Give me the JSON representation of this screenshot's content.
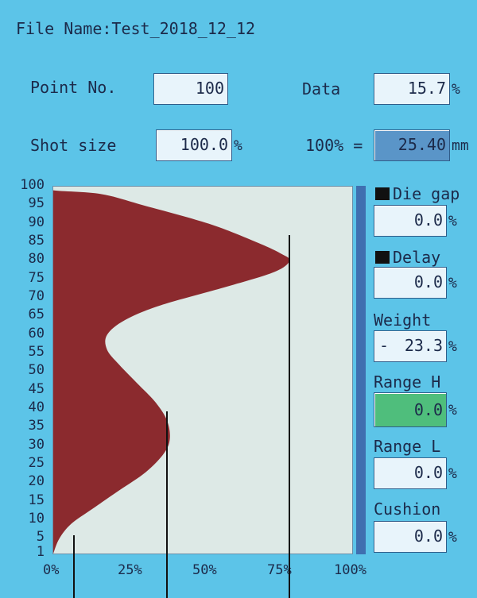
{
  "file_name": "File Name:Test_2018_12_12",
  "point_no": {
    "label": "Point No.",
    "value": "100"
  },
  "data": {
    "label": "Data",
    "value": "15.7",
    "unit": "%"
  },
  "shot_size": {
    "label": "Shot size",
    "value": "100.0",
    "unit": "%"
  },
  "hundred_pct": {
    "label": "100% =",
    "value": "25.40",
    "unit": "mm"
  },
  "chart": {
    "y_ticks": [
      "100",
      "95",
      "90",
      "85",
      "80",
      "75",
      "70",
      "65",
      "60",
      "55",
      "50",
      "45",
      "40",
      "35",
      "30",
      "25",
      "20",
      "15",
      "10",
      "5",
      "1"
    ],
    "x_ticks": [
      "0%",
      "25%",
      "50%",
      "75%",
      "100%"
    ]
  },
  "side": {
    "die_gap": {
      "label": "Die gap",
      "value": "0.0",
      "unit": "%"
    },
    "delay": {
      "label": "Delay",
      "value": "0.0",
      "unit": "%"
    },
    "weight": {
      "label": "Weight",
      "prefix": "-",
      "value": "23.3",
      "unit": "%"
    },
    "range_h": {
      "label": "Range H",
      "value": "0.0",
      "unit": "%"
    },
    "range_l": {
      "label": "Range L",
      "value": "0.0",
      "unit": "%"
    },
    "cushion": {
      "label": "Cushion",
      "value": "0.0",
      "unit": "%"
    }
  },
  "colors": {
    "background": "#5cc4e8",
    "profile_fill": "#8b2a2e",
    "plot_bg": "#dde9e6",
    "highlight": "#4fbe7c"
  },
  "chart_data": {
    "type": "area",
    "xlabel": "",
    "ylabel": "",
    "xlim": [
      0,
      100
    ],
    "ylim": [
      1,
      100
    ],
    "profile": [
      {
        "y": 100,
        "x": 0
      },
      {
        "y": 99,
        "x": 0
      },
      {
        "y": 98,
        "x": 16
      },
      {
        "y": 95,
        "x": 30
      },
      {
        "y": 90,
        "x": 52
      },
      {
        "y": 85,
        "x": 68
      },
      {
        "y": 82,
        "x": 76
      },
      {
        "y": 80,
        "x": 79
      },
      {
        "y": 77,
        "x": 74
      },
      {
        "y": 73,
        "x": 58
      },
      {
        "y": 68,
        "x": 36
      },
      {
        "y": 64,
        "x": 24
      },
      {
        "y": 60,
        "x": 18
      },
      {
        "y": 56,
        "x": 18
      },
      {
        "y": 52,
        "x": 22
      },
      {
        "y": 47,
        "x": 28
      },
      {
        "y": 42,
        "x": 34
      },
      {
        "y": 37,
        "x": 38
      },
      {
        "y": 32,
        "x": 39
      },
      {
        "y": 28,
        "x": 37
      },
      {
        "y": 23,
        "x": 31
      },
      {
        "y": 18,
        "x": 22
      },
      {
        "y": 13,
        "x": 13
      },
      {
        "y": 9,
        "x": 6
      },
      {
        "y": 5,
        "x": 2
      },
      {
        "y": 1,
        "x": 0
      }
    ],
    "cursors_x": [
      7,
      38,
      79
    ]
  }
}
